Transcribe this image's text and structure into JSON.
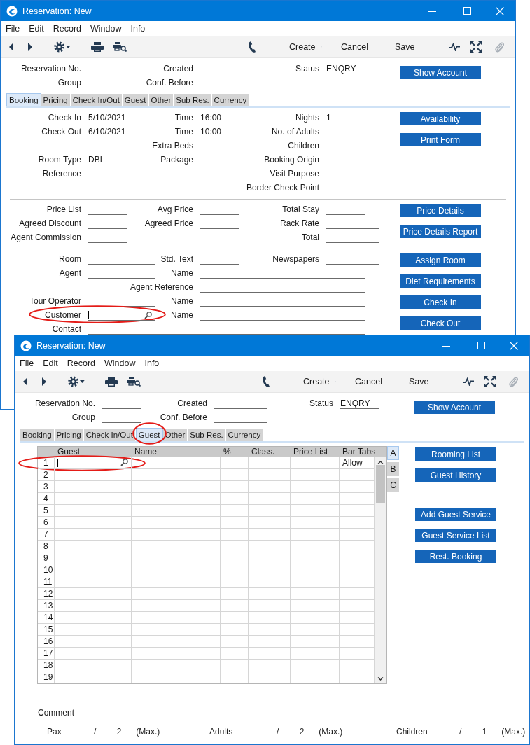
{
  "windows": [
    {
      "title": "Reservation: New",
      "menu": [
        "File",
        "Edit",
        "Record",
        "Window",
        "Info"
      ],
      "toolbar": {
        "create": "Create",
        "cancel": "Cancel",
        "save": "Save"
      },
      "header": {
        "fields": [
          {
            "label": "Reservation No."
          },
          {
            "label": "Created"
          },
          {
            "label": "Status",
            "value": "ENQRY"
          },
          {
            "label": "Group"
          },
          {
            "label": "Conf. Before"
          }
        ],
        "buttons": [
          "Show Account"
        ]
      },
      "tabs": [
        {
          "label": "Booking",
          "selected": true
        },
        {
          "label": "Pricing",
          "selected": false
        },
        {
          "label": "Check In/Out",
          "selected": false
        },
        {
          "label": "Guest",
          "selected": false
        },
        {
          "label": "Other",
          "selected": false
        },
        {
          "label": "Sub Res.",
          "selected": false
        },
        {
          "label": "Currency",
          "selected": false
        }
      ],
      "sections": [
        {
          "fields": [
            {
              "label": "Check In",
              "value": "5/10/2021"
            },
            {
              "label": "Time",
              "value": "16:00"
            },
            {
              "label": "Nights",
              "value": "1"
            },
            {
              "label": "Check Out",
              "value": "6/10/2021"
            },
            {
              "label": "Time",
              "value": "10:00"
            },
            {
              "label": "No. of Adults"
            },
            {
              "label": "Extra Beds"
            },
            {
              "label": "Children"
            },
            {
              "label": "Room Type",
              "value": "DBL"
            },
            {
              "label": "Package"
            },
            {
              "label": "Booking Origin"
            },
            {
              "label": "Reference"
            },
            {
              "label": "Visit Purpose"
            },
            {
              "label": "Border Check Point"
            }
          ],
          "buttons": [
            "Availability",
            "Print Form"
          ]
        },
        {
          "fields": [
            {
              "label": "Price List"
            },
            {
              "label": "Avg Price"
            },
            {
              "label": "Total Stay"
            },
            {
              "label": "Agreed Discount"
            },
            {
              "label": "Agreed Price"
            },
            {
              "label": "Rack Rate"
            },
            {
              "label": "Agent Commission"
            },
            {
              "label": "Total"
            }
          ],
          "buttons": [
            "Price Details",
            "Price Details Report"
          ]
        },
        {
          "fields": [
            {
              "label": "Room"
            },
            {
              "label": "Std. Text"
            },
            {
              "label": "Newspapers"
            },
            {
              "label": "Agent"
            },
            {
              "label": "Name"
            },
            {
              "label": "Agent Reference"
            },
            {
              "label": "Tour Operator"
            },
            {
              "label": "Name"
            },
            {
              "label": "Customer",
              "focused": true,
              "highlighted": true
            },
            {
              "label": "Name"
            },
            {
              "label": "Contact"
            }
          ],
          "buttons": [
            "Assign Room",
            "Diet Requirements",
            "Check In",
            "Check Out"
          ]
        }
      ]
    },
    {
      "title": "Reservation: New",
      "menu": [
        "File",
        "Edit",
        "Record",
        "Window",
        "Info"
      ],
      "toolbar": {
        "create": "Create",
        "cancel": "Cancel",
        "save": "Save"
      },
      "header": {
        "fields": [
          {
            "label": "Reservation No."
          },
          {
            "label": "Created"
          },
          {
            "label": "Status",
            "value": "ENQRY"
          },
          {
            "label": "Group"
          },
          {
            "label": "Conf. Before"
          }
        ],
        "buttons": [
          "Show Account"
        ]
      },
      "tabs": [
        {
          "label": "Booking",
          "selected": false
        },
        {
          "label": "Pricing",
          "selected": false
        },
        {
          "label": "Check In/Out",
          "selected": false
        },
        {
          "label": "Guest",
          "selected": true,
          "highlighted": true
        },
        {
          "label": "Other",
          "selected": false
        },
        {
          "label": "Sub Res.",
          "selected": false
        },
        {
          "label": "Currency",
          "selected": false
        }
      ],
      "guest_table": {
        "columns": [
          "Guest",
          "Name",
          "%",
          "Class.",
          "Price List",
          "Bar Tabs"
        ],
        "rows": [
          {
            "number": "1",
            "bar_tabs": "Allow",
            "focused": true,
            "highlighted": true
          },
          {
            "number": "2"
          },
          {
            "number": "3"
          },
          {
            "number": "4"
          },
          {
            "number": "5"
          },
          {
            "number": "6"
          },
          {
            "number": "7"
          },
          {
            "number": "8"
          },
          {
            "number": "9"
          },
          {
            "number": "10"
          },
          {
            "number": "11"
          },
          {
            "number": "12"
          },
          {
            "number": "13"
          },
          {
            "number": "14"
          },
          {
            "number": "15"
          },
          {
            "number": "16"
          },
          {
            "number": "17"
          },
          {
            "number": "18"
          },
          {
            "number": "19"
          }
        ]
      },
      "side_tabs": [
        {
          "label": "A",
          "selected": true
        },
        {
          "label": "B",
          "selected": false
        },
        {
          "label": "C",
          "selected": false
        }
      ],
      "buttons": [
        "Rooming List",
        "Guest History",
        "Add Guest Service",
        "Guest Service List",
        "Rest. Booking"
      ],
      "comment": {
        "label": "Comment"
      },
      "counts": [
        {
          "label": "Pax",
          "separator": "/",
          "max": "2",
          "max_label": "(Max.)"
        },
        {
          "label": "Adults",
          "separator": "/",
          "max": "2",
          "max_label": "(Max.)"
        },
        {
          "label": "Children",
          "separator": "/",
          "max": "1",
          "max_label": "(Max.)"
        }
      ]
    }
  ]
}
